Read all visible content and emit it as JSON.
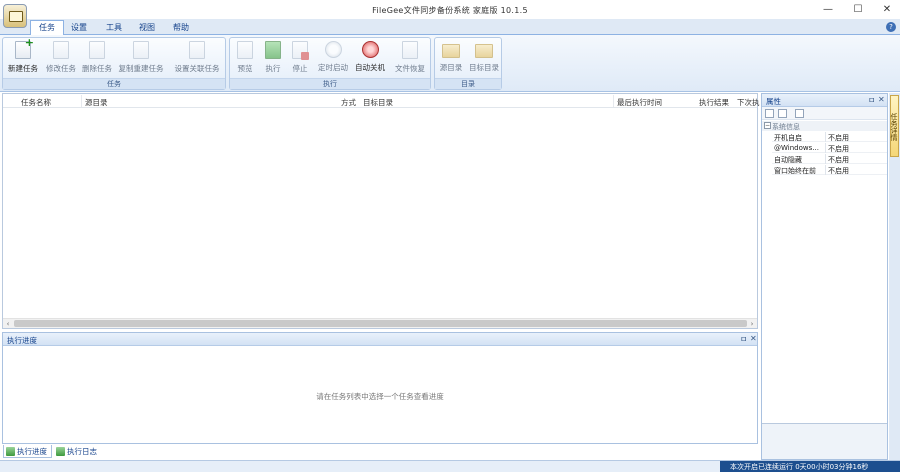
{
  "window": {
    "title": "FileGee文件同步备份系统 家庭版 10.1.5",
    "minimize": "—",
    "maximize": "☐",
    "close": "✕"
  },
  "ribbon": {
    "tabs": [
      "任务",
      "设置",
      "工具",
      "视图",
      "帮助"
    ],
    "active_tab": "任务",
    "groups": {
      "task": {
        "label": "任务",
        "buttons": [
          "新建任务",
          "修改任务",
          "删除任务",
          "复制重建任务",
          "设置关联任务"
        ]
      },
      "execute": {
        "label": "执行",
        "buttons": [
          "预览",
          "执行",
          "停止",
          "定时启动",
          "自动关机",
          "文件恢复"
        ]
      },
      "catalog": {
        "label": "目录",
        "buttons": [
          "源目录",
          "目标目录"
        ]
      }
    }
  },
  "task_list": {
    "columns": [
      "任务名称",
      "源目录",
      "方式",
      "目标目录",
      "最后执行时间",
      "执行结果",
      "下次执"
    ]
  },
  "progress_pane": {
    "title": "执行进度",
    "pin": "ㅁ",
    "close": "✕",
    "hint": "请在任务列表中选择一个任务查看进度"
  },
  "bottom_tabs": [
    "执行进度",
    "执行日志"
  ],
  "properties": {
    "title": "属性",
    "pin": "ㅁ",
    "close": "✕",
    "category": "系统信息",
    "rows": [
      {
        "key": "开机自启",
        "value": "不启用"
      },
      {
        "key": "@Windows...",
        "value": "不启用"
      },
      {
        "key": "自动隐藏",
        "value": "不启用"
      },
      {
        "key": "窗口始终在前",
        "value": "不启用"
      }
    ]
  },
  "side_tab": "任务详情",
  "status": {
    "uptime": "本次开启已连续运行 0天00小时03分钟16秒"
  }
}
